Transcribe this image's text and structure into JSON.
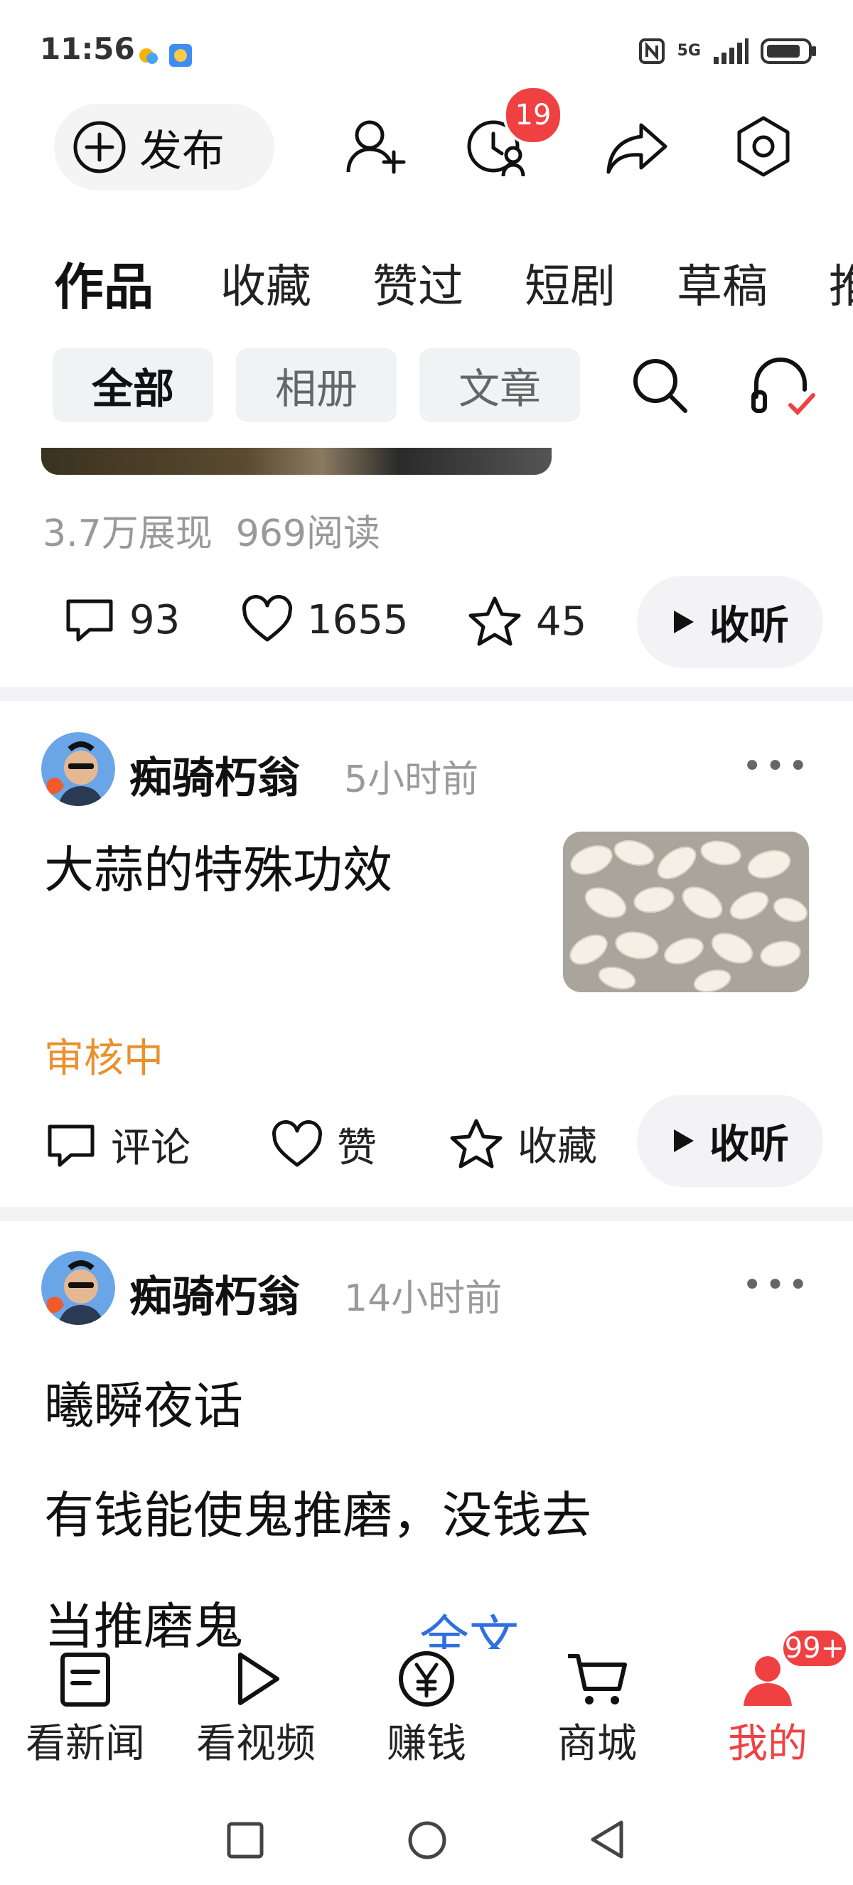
{
  "status_bar": {
    "time": "11:56",
    "network": "5G"
  },
  "header": {
    "publish_label": "发布",
    "notification_count": "19"
  },
  "tabs": [
    "作品",
    "收藏",
    "赞过",
    "短剧",
    "草稿",
    "推"
  ],
  "filters": [
    "全部",
    "相册",
    "文章"
  ],
  "post1": {
    "stats": "3.7万展现  969阅读",
    "comments": "93",
    "likes": "1655",
    "favorites": "45",
    "listen_label": "收听"
  },
  "post2": {
    "author": "痴骑朽翁",
    "time": "5小时前",
    "title": "大蒜的特殊功效",
    "status": "审核中",
    "comment_label": "评论",
    "like_label": "赞",
    "favorite_label": "收藏",
    "listen_label": "收听"
  },
  "post3": {
    "author": "痴骑朽翁",
    "time": "14小时前",
    "line1": "曦瞬夜话",
    "line2": "有钱能使鬼推磨，没钱去",
    "line3": "当推磨鬼",
    "fulltext_label": "全文"
  },
  "bottom_nav": {
    "items": [
      {
        "label": "看新闻",
        "icon": "news-icon"
      },
      {
        "label": "看视频",
        "icon": "play-icon"
      },
      {
        "label": "赚钱",
        "icon": "yuan-icon"
      },
      {
        "label": "商城",
        "icon": "cart-icon"
      },
      {
        "label": "我的",
        "icon": "profile-icon"
      }
    ],
    "profile_badge": "99+",
    "active_color": "#f04142"
  }
}
